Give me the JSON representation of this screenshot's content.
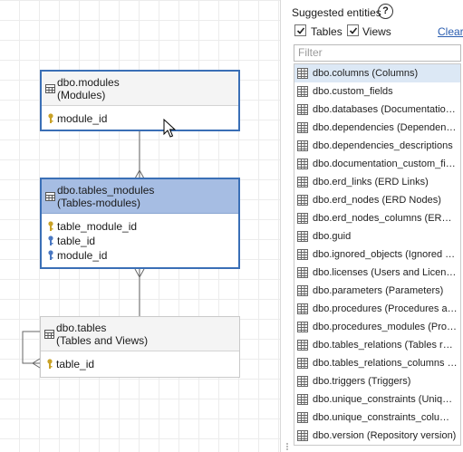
{
  "diagram": {
    "entities": [
      {
        "name": "dbo.modules",
        "caption": "(Modules)",
        "fields": [
          {
            "name": "module_id",
            "key": "pk"
          }
        ]
      },
      {
        "name": "dbo.tables_modules",
        "caption": "(Tables-modules)",
        "fields": [
          {
            "name": "table_module_id",
            "key": "pk"
          },
          {
            "name": "table_id",
            "key": "fk"
          },
          {
            "name": "module_id",
            "key": "fk"
          }
        ]
      },
      {
        "name": "dbo.tables",
        "caption": "(Tables and Views)",
        "fields": [
          {
            "name": "table_id",
            "key": "pk"
          }
        ]
      }
    ],
    "colors": {
      "selection_border": "#3a6fb6",
      "active_header": "#a6bde3",
      "pk_key": "#c9a227",
      "fk_key": "#4a78c2"
    }
  },
  "panel": {
    "title": "Suggested entities",
    "help_icon": "?",
    "tables_label": "Tables",
    "views_label": "Views",
    "tables_checked": true,
    "views_checked": true,
    "clear_label": "Clear",
    "filter_placeholder": "Filter",
    "items": [
      "dbo.columns (Columns)",
      "dbo.custom_fields",
      "dbo.databases (Documentations)",
      "dbo.dependencies (Dependencies)",
      "dbo.dependencies_descriptions",
      "dbo.documentation_custom_fields",
      "dbo.erd_links (ERD Links)",
      "dbo.erd_nodes (ERD Nodes)",
      "dbo.erd_nodes_columns (ERD Nodes Columns)",
      "dbo.guid",
      "dbo.ignored_objects (Ignored objects)",
      "dbo.licenses (Users and Licenses)",
      "dbo.parameters (Parameters)",
      "dbo.procedures (Procedures and functions)",
      "dbo.procedures_modules (Procedures-modules)",
      "dbo.tables_relations (Tables relations)",
      "dbo.tables_relations_columns (Tables relations columns)",
      "dbo.triggers (Triggers)",
      "dbo.unique_constraints (Unique constraints)",
      "dbo.unique_constraints_columns (Unique constraints columns)",
      "dbo.version (Repository version)"
    ]
  }
}
